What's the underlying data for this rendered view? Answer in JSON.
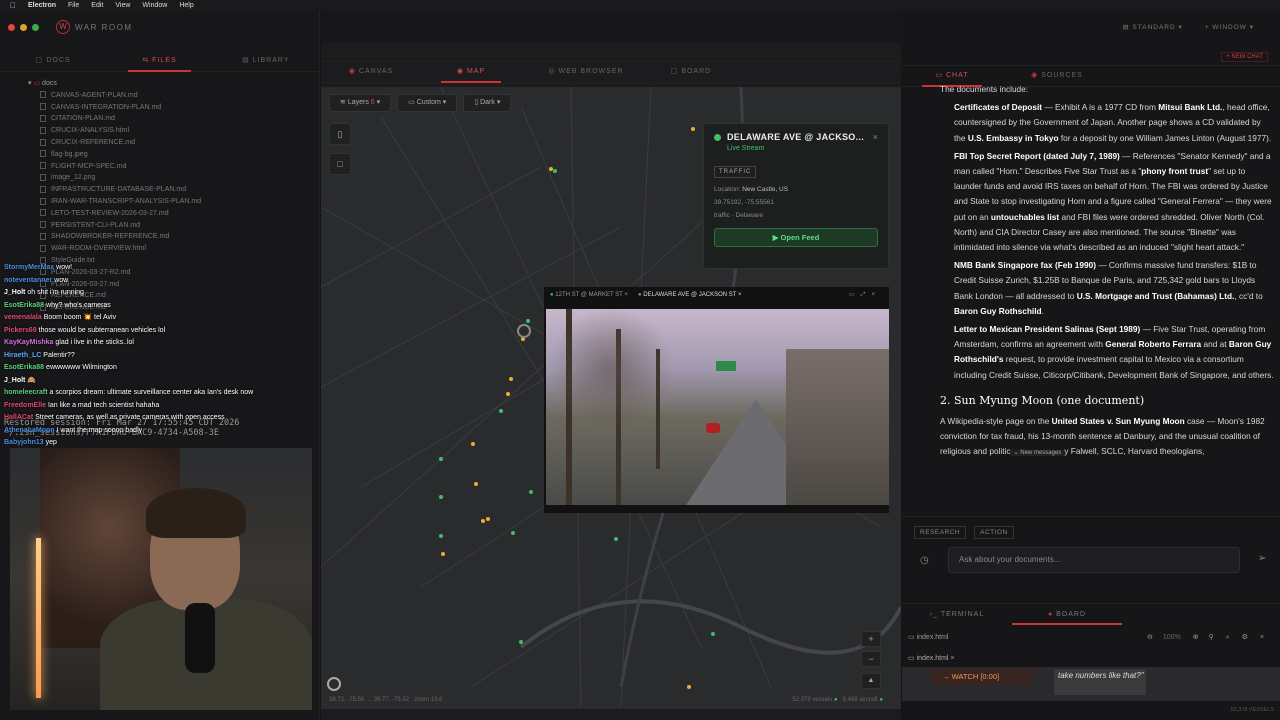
{
  "menubar": {
    "apple": "",
    "items": [
      "Electron",
      "File",
      "Edit",
      "View",
      "Window",
      "Help"
    ]
  },
  "left": {
    "logo": "W",
    "app_title": "WAR ROOM",
    "tabs": [
      "DOCS",
      "FILES",
      "LIBRARY"
    ],
    "folder": "docs",
    "files": [
      "CANVAS-AGENT-PLAN.md",
      "CANVAS-INTEGRATION-PLAN.md",
      "CITATION-PLAN.md",
      "CRUCIX-ANALYSIS.html",
      "CRUCIX-REFERENCE.md",
      "flag-bg.jpeg",
      "FLIGHT-MCP-SPEC.md",
      "image_12.png",
      "INFRASTRUCTURE-DATABASE-PLAN.md",
      "IRAN-WAR-TRANSCRIPT-ANALYSIS-PLAN.md",
      "LETO-TEST-REVIEW-2026-03-27.md",
      "PERSISTENT-CLI-PLAN.md",
      "SHADOWBROKER-REFERENCE.md",
      "WAR-ROOM-OVERVIEW.html",
      "StyleGuide.txt",
      "PLAN-2026-03-27-R2.md",
      "PLAN-2026-03-27.md",
      "REFERENCE.md",
      "REFERENCE.md"
    ]
  },
  "chat": [
    {
      "user": "StormyMerMax",
      "color": "#4a8fe0",
      "msg": "wow!"
    },
    {
      "user": "noteventanner",
      "color": "#4a8fe0",
      "msg": "wow"
    },
    {
      "user": "J_Holt",
      "color": "#ffffff",
      "msg": "oh shit i'm running"
    },
    {
      "user": "EsotErika88",
      "color": "#5ad07a",
      "msg": "why? who's cameras"
    },
    {
      "user": "vemenalala",
      "color": "#e04a6a",
      "msg": "Boom boom 💥 tel Aviv"
    },
    {
      "user": "Pickers69",
      "color": "#e04a6a",
      "msg": "those would be subterranean vehicles lol"
    },
    {
      "user": "KayKayMishka",
      "color": "#d070e0",
      "msg": "glad i live in the sticks..lol"
    },
    {
      "user": "Hiraeth_LC",
      "color": "#5aaaf0",
      "msg": "Palentir??"
    },
    {
      "user": "EsotErika88",
      "color": "#5ad07a",
      "msg": "ewwwwww Wilmington"
    },
    {
      "user": "J_Holt",
      "color": "#ffffff",
      "msg": "🙈"
    },
    {
      "user": "homeleecraft",
      "color": "#5ad07a",
      "msg": "a scorpios dream: ultimate surveillance center aka Ian's desk now"
    },
    {
      "user": "FreedomElle",
      "color": "#e04a6a",
      "msg": "Ian like a mad tech scientist hahaha"
    },
    {
      "user": "HallACat",
      "color": "#e04a6a",
      "msg": "Street cameras, as well as private cameras with open access"
    },
    {
      "user": "AthenaLaMoon",
      "color": "#4a8fe0",
      "msg": "I want the map soooo badly"
    },
    {
      "user": "Babyjohn13",
      "color": "#4a8fe0",
      "msg": "yep"
    }
  ],
  "terminal": {
    "line1": "Restored session: Fri Mar 27 17:55:45 CDT 2026",
    "line2": "~/.zsh_sessions/F7A1FDA6-BAC9-4734-A508-3E"
  },
  "mid": {
    "tabs": [
      "CANVAS",
      "MAP",
      "WEB BROWSER",
      "BOARD"
    ],
    "layers_label": "Layers",
    "layers_count": "6",
    "custom_label": "Custom",
    "dark_label": "Dark",
    "card": {
      "title": "DELAWARE AVE @ JACKSO...",
      "status": "Live Stream",
      "badge": "TRAFFIC",
      "location_label": "Location:",
      "location": "New Castle, US",
      "coords": "39.75192, -75.55561",
      "source": "traffic · Delaware",
      "button": "Open Feed"
    },
    "video": {
      "tab1": "12TH ST @ MARKET ST",
      "tab2": "DELAWARE AVE @ JACKSON ST"
    },
    "footer_left": "38.72, -75.58 → 39.77, -75.52 · zoom 13.6",
    "footer_vessels": "52,378 vessels",
    "footer_aircraft": "8,488 aircraft"
  },
  "right": {
    "view_label": "STANDARD",
    "window_label": "WINDOW",
    "new_chat": "+ NEW CHAT",
    "tabs": [
      "CHAT",
      "SOURCES"
    ],
    "intro": "The documents include:",
    "p1_b1": "Certificates of Deposit",
    "p1_t1": " — Exhibit A is a 1977 CD from ",
    "p1_b2": "Mitsui Bank Ltd.",
    "p1_t2": ", head office, countersigned by the Government of Japan. Another page shows a CD validated by the ",
    "p1_b3": "U.S. Embassy in Tokyo",
    "p1_t3": " for a deposit by one William James Linton (August 1977).",
    "p2_b1": "FBI Top Secret Report (dated July 7, 1989)",
    "p2_t1": " — References \"Senator Kennedy\" and a man called \"Horn.\" Describes Five Star Trust as a \"",
    "p2_b2": "phony front trust",
    "p2_t2": "\" set up to launder funds and avoid IRS taxes on behalf of Horn. The FBI was ordered by Justice and State to stop investigating Horn and a figure called \"General Ferrera\" — they were put on an ",
    "p2_b3": "untouchables list",
    "p2_t3": " and FBI files were ordered shredded. Oliver North (Col. North) and CIA Director Casey are also mentioned. The source \"Binette\" was intimidated into silence via what's described as an induced \"slight heart attack.\"",
    "p3_b1": "NMB Bank Singapore fax (Feb 1990)",
    "p3_t1": " — Confirms massive fund transfers: $1B to Credit Suisse Zurich, $1.25B to Banque de Paris, and 725,342 gold bars to Lloyds Bank London — all addressed to ",
    "p3_b2": "U.S. Mortgage and Trust (Bahamas) Ltd.",
    "p3_t2": ", cc'd to ",
    "p3_b3": "Baron Guy Rothschild",
    "p3_t3": ".",
    "p4_b1": "Letter to Mexican President Salinas (Sept 1989)",
    "p4_t1": " — Five Star Trust, operating from Amsterdam, confirms an agreement with ",
    "p4_b2": "General Roberto Ferrara",
    "p4_t2": " and at ",
    "p4_b3": "Baron Guy Rothschild's",
    "p4_t3": " request, to provide investment capital to Mexico via a consortium including Credit Suisse, Citicorp/Citibank, Development Bank of Singapore, and others.",
    "heading": "2. Sun Myung Moon (one document)",
    "p5_t1": "A Wikipedia-style page on the ",
    "p5_b1": "United States v. Sun Myung Moon",
    "p5_t2": " case — Moon's 1982 conviction for tax fraud, his 13-month sentence at Danbury, and the unusual coalition of religious and politic",
    "new_messages": "New messages",
    "p5_t3": "y Falwell, SCLC, Harvard theologians,",
    "chip_research": "RESEARCH",
    "chip_action": "ACTION",
    "input_placeholder": "Ask about your documents...",
    "bottom_tabs": [
      "TERMINAL",
      "BOARD"
    ],
    "file_name": "index.html",
    "zoom": "100%",
    "file_tab": "index.html",
    "watch": "→ WATCH [0:00]",
    "board_text": "take numbers like that?\"",
    "footer": "52,378 VESSELS"
  },
  "colors": {
    "accent": "#d23c3c",
    "live": "#3fbf6a",
    "marker": "#e8b030"
  }
}
